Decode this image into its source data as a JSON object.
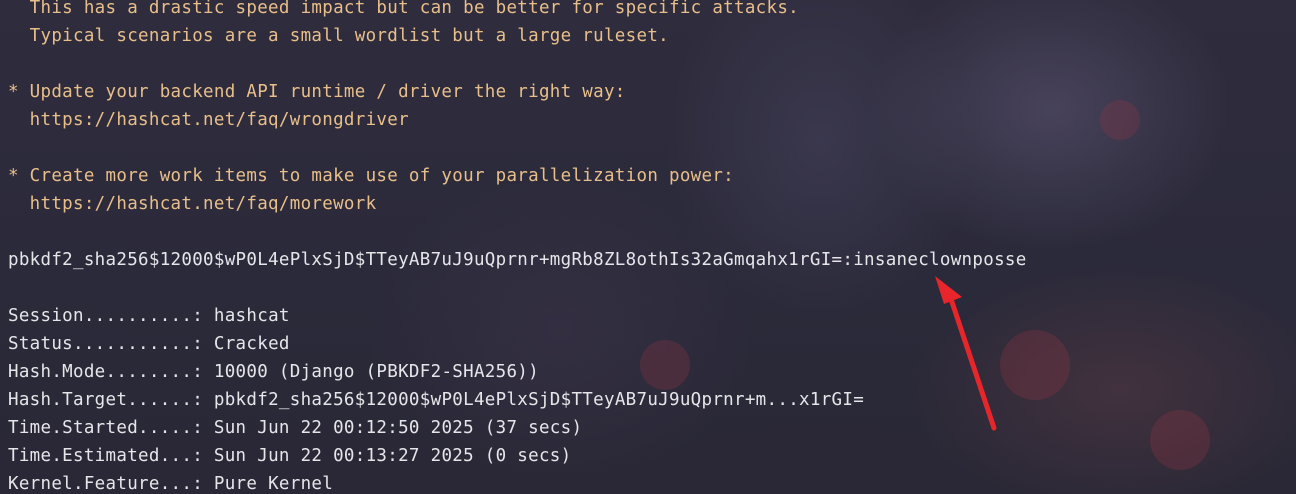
{
  "terminal": {
    "advice": [
      "  This has a drastic speed impact but can be better for specific attacks.",
      "  Typical scenarios are a small wordlist but a large ruleset.",
      "* Update your backend API runtime / driver the right way:",
      "  https://hashcat.net/faq/wrongdriver",
      "* Create more work items to make use of your parallelization power:",
      "  https://hashcat.net/faq/morework"
    ],
    "cracked_line": "pbkdf2_sha256$12000$wP0L4ePlxSjD$TTeyAB7uJ9uQprnr+mgRb8ZL8othIs32aGmqahx1rGI=:insaneclownposse",
    "status": [
      {
        "key": "Session..........:",
        "value": "hashcat"
      },
      {
        "key": "Status...........:",
        "value": "Cracked"
      },
      {
        "key": "Hash.Mode........:",
        "value": "10000 (Django (PBKDF2-SHA256))"
      },
      {
        "key": "Hash.Target......:",
        "value": "pbkdf2_sha256$12000$wP0L4ePlxSjD$TTeyAB7uJ9uQprnr+m...x1rGI="
      },
      {
        "key": "Time.Started.....:",
        "value": "Sun Jun 22 00:12:50 2025 (37 secs)"
      },
      {
        "key": "Time.Estimated...:",
        "value": "Sun Jun 22 00:13:27 2025 (0 secs)"
      },
      {
        "key": "Kernel.Feature...:",
        "value": "Pure Kernel"
      }
    ]
  },
  "annotation": {
    "arrow_color": "#e8252b"
  },
  "colors": {
    "warning_text": "#e8bf8a",
    "normal_text": "#e6e6ea"
  }
}
